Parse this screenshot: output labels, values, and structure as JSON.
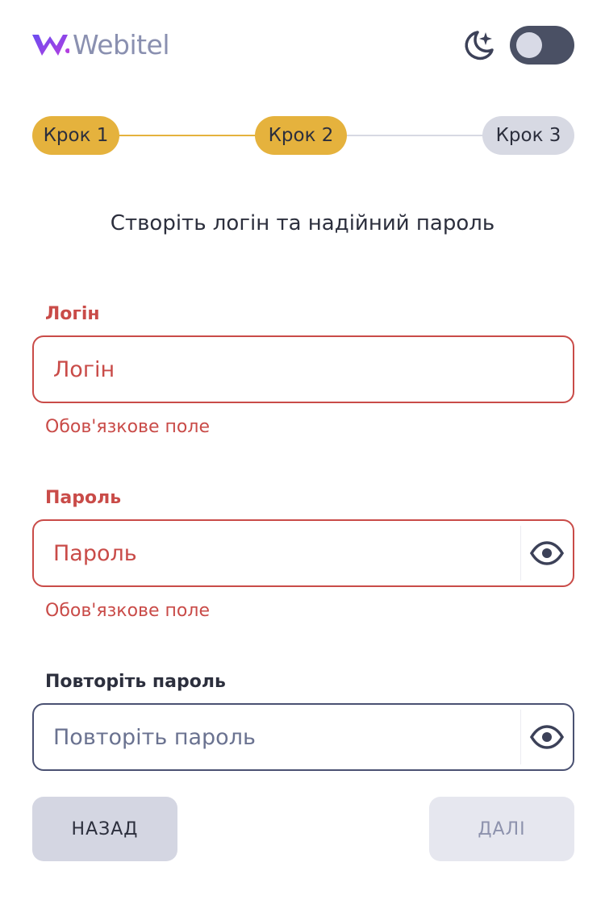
{
  "header": {
    "brand": "Webitel",
    "icons": {
      "logo": "webitel-logo",
      "theme": "moon-stars-icon"
    },
    "theme_toggle": {
      "on": true
    }
  },
  "stepper": {
    "steps": [
      {
        "label": "Крок 1",
        "state": "done"
      },
      {
        "label": "Крок 2",
        "state": "active"
      },
      {
        "label": "Крок 3",
        "state": "pending"
      }
    ]
  },
  "title": "Створіть логін та надійний пароль",
  "form": {
    "login": {
      "label": "Логін",
      "placeholder": "Логін",
      "value": "",
      "error": "Обов'язкове поле"
    },
    "password": {
      "label": "Пароль",
      "placeholder": "Пароль",
      "value": "",
      "error": "Обов'язкове поле"
    },
    "repeat_password": {
      "label": "Повторіть пароль",
      "placeholder": "Повторіть пароль",
      "value": ""
    }
  },
  "buttons": {
    "back": "НАЗАД",
    "next": "ДАЛІ"
  },
  "colors": {
    "accent_step": "#e5b23d",
    "error": "#c94b48",
    "brand": "#8a90b0",
    "logo_purple": "#7b3ff2"
  }
}
